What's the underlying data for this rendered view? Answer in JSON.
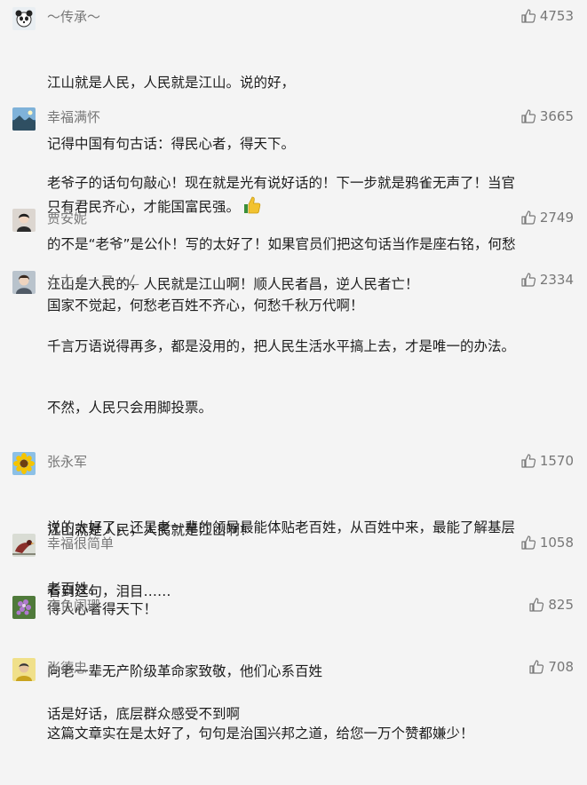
{
  "comments": [
    {
      "name": "～传承～",
      "likes": "4753",
      "avatar_icon": "panda-avatar-icon",
      "lines": [
        "江山就是人民，人民就是江山。说的好，",
        "记得中国有句古话：得民心者，得天下。",
        "只有君民齐心，才能国富民强。"
      ],
      "trailing_icon": "thumbs-up-emoji-icon"
    },
    {
      "name": "幸福满怀",
      "likes": "3665",
      "avatar_icon": "landscape-avatar-icon",
      "lines": [
        "老爷子的话句句敲心！现在就是光有说好话的！下一步就是鸦雀无声了！当官",
        "的不是“老爷”是公仆！写的太好了！如果官员们把这句话当作是座右铭，何愁",
        "国家不觉起，何愁老百姓不齐心，何愁千秋万代啊！"
      ]
    },
    {
      "name": "贾安妮",
      "likes": "2749",
      "avatar_icon": "person-avatar-icon",
      "lines": [
        "江山是人民的，人民就是江山啊！顺人民者昌，逆人民者亡！"
      ]
    },
    {
      "name": "ㄙㄤㄑㄧㄡㄧㄥ",
      "likes": "2334",
      "avatar_icon": "person-photo-avatar-icon",
      "lines": [
        "千言万语说得再多，都是没用的，把人民生活水平搞上去，才是唯一的办法。",
        "不然，人民只会用脚投票。",
        "",
        "江山就是人民，人民就是江山啊！",
        "看到这句，泪目……",
        "",
        "话是好话，底层群众感受不到啊"
      ]
    },
    {
      "name": "张永军",
      "likes": "1570",
      "avatar_icon": "sunflower-avatar-icon",
      "lines": [
        "说的太好了，还是老一辈的领导最能体贴老百姓，从百姓中来，最能了解基层",
        "老百姓。"
      ]
    },
    {
      "name": "幸福很简单",
      "likes": "1058",
      "avatar_icon": "bird-avatar-icon",
      "lines": [
        "得人心者得天下！"
      ]
    },
    {
      "name": "夜色阑珊",
      "likes": "825",
      "avatar_icon": "flower-avatar-icon",
      "lines": [
        "向老一辈无产阶级革命家致敬，他们心系百姓"
      ]
    },
    {
      "name": "张德忠",
      "likes": "708",
      "avatar_icon": "person-yellow-avatar-icon",
      "lines": [
        "这篇文章实在是太好了，句句是治国兴邦之道，给您一万个赞都嫌少！"
      ]
    }
  ]
}
